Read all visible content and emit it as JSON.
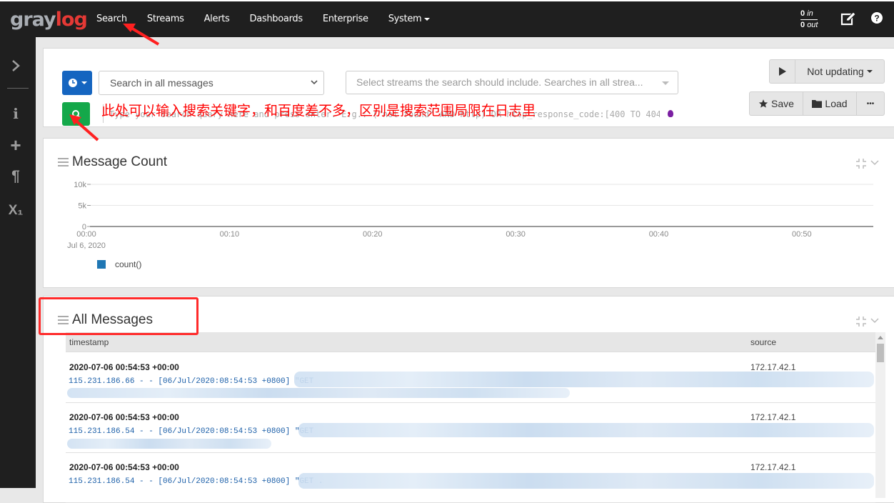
{
  "app": {
    "logo_part1": "gray",
    "logo_part2": "log"
  },
  "nav": {
    "items": [
      {
        "label": "Search"
      },
      {
        "label": "Streams"
      },
      {
        "label": "Alerts"
      },
      {
        "label": "Dashboards"
      },
      {
        "label": "Enterprise"
      },
      {
        "label": "System"
      }
    ],
    "throughput": {
      "in_count": "0",
      "in_label": "in",
      "out_count": "0",
      "out_label": "out"
    },
    "icons": {
      "edit": "edit-icon",
      "help": "help-icon"
    }
  },
  "sidebar": {
    "items": [
      {
        "icon": "chevron-right-icon",
        "glyph": "›"
      },
      {
        "icon": "info-icon",
        "glyph": "i"
      },
      {
        "icon": "plus-icon",
        "glyph": "+"
      },
      {
        "icon": "paragraph-icon",
        "glyph": "¶"
      },
      {
        "icon": "subscript-icon",
        "glyph": "X₁"
      }
    ]
  },
  "search": {
    "time_range": "Search in all messages",
    "streams_placeholder": "Select streams the search should include. Searches in all strea...",
    "query_placeholder": "Type your search query here and press enter. E.g.: (\"not found\" AND http) OR http_response_code:[400 TO 404]",
    "refresh_label": "Not updating",
    "save_label": "Save",
    "load_label": "Load",
    "more_label": "•••"
  },
  "annotation": {
    "text": "此处可以输入搜索关键字，和百度差不多，区别是搜索范围局限在日志里",
    "color": "#ff0000"
  },
  "widgets": {
    "message_count": {
      "title": "Message Count"
    },
    "all_messages": {
      "title": "All Messages"
    }
  },
  "chart_data": {
    "type": "bar",
    "title": "Message Count",
    "xlabel": "",
    "ylabel": "",
    "x_ticks": [
      "00:00",
      "00:10",
      "00:20",
      "00:30",
      "00:40",
      "00:50"
    ],
    "x_sublabel": "Jul 6, 2020",
    "y_ticks": [
      "0",
      "5k",
      "10k"
    ],
    "ylim": [
      0,
      10000
    ],
    "xlim_minutes": [
      0,
      55
    ],
    "grid": true,
    "legend": {
      "position": "bottom-left",
      "entries": [
        {
          "name": "count()",
          "color": "#1f77b4"
        }
      ]
    },
    "series": [
      {
        "name": "count()",
        "values": []
      }
    ]
  },
  "messages": {
    "columns": [
      "timestamp",
      "source"
    ],
    "rows": [
      {
        "timestamp": "2020-07-06 00:54:53 +00:00",
        "source": "172.17.42.1",
        "message": "115.231.186.66 - - [06/Jul/2020:08:54:53 +0800] \"GET"
      },
      {
        "timestamp": "2020-07-06 00:54:53 +00:00",
        "source": "172.17.42.1",
        "message": "115.231.186.54 - - [06/Jul/2020:08:54:53 +0800] \"GET"
      },
      {
        "timestamp": "2020-07-06 00:54:53 +00:00",
        "source": "172.17.42.1",
        "message": "115.231.186.54 - - [06/Jul/2020:08:54:53 +0800] \"GET ."
      }
    ]
  }
}
